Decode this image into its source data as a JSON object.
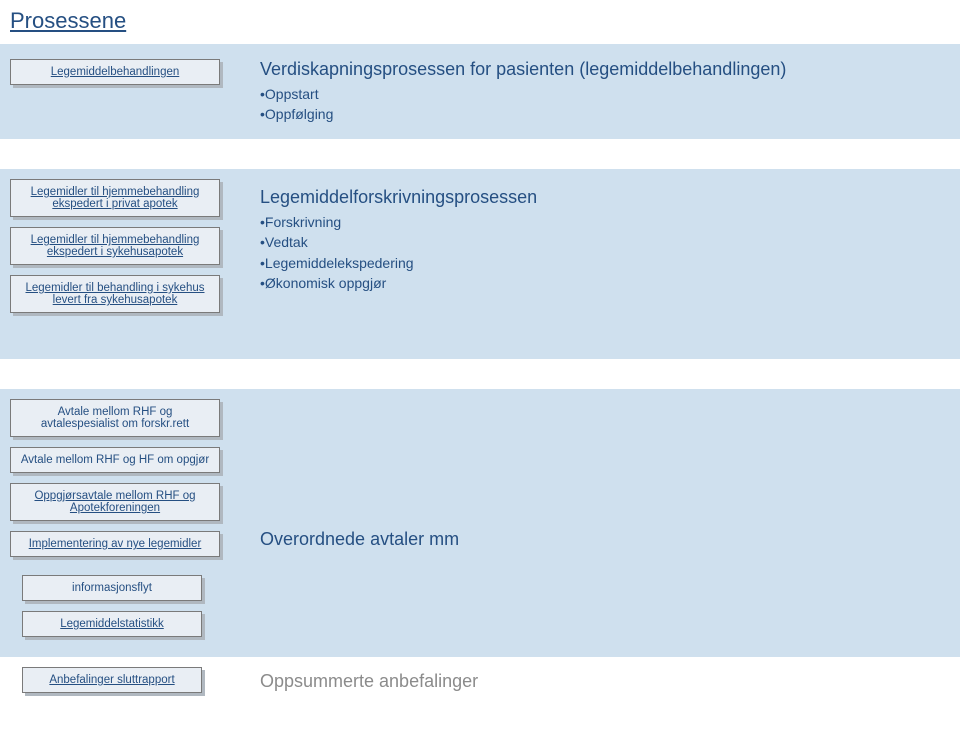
{
  "title": "Prosessene",
  "band1": {
    "box1": "Legemiddelbehandlingen",
    "desc_title": "Verdiskapningsprosessen for pasienten (legemiddelbehandlingen)",
    "desc_line1": "•Oppstart",
    "desc_line2": "•Oppfølging"
  },
  "band2": {
    "box1": "Legemidler til hjemmebehandling ekspedert i privat apotek",
    "box2": "Legemidler til hjemmebehandling ekspedert i sykehusapotek",
    "box3": "Legemidler til behandling i sykehus levert fra sykehusapotek",
    "desc_title": "Legemiddelforskrivningsprosessen",
    "desc_line1": "•Forskrivning",
    "desc_line2": "•Vedtak",
    "desc_line3": "•Legemiddelekspedering",
    "desc_line4": "•Økonomisk oppgjør"
  },
  "band3": {
    "box1": "Avtale mellom RHF og avtalespesialist om forskr.rett",
    "box2": "Avtale mellom RHF og HF om opgjør",
    "box3": "Oppgjørsavtale mellom RHF og Apotekforeningen",
    "box4": "Implementering av nye legemidler",
    "box5": "informasjonsflyt",
    "box6": "Legemiddelstatistikk",
    "desc_title": "Overordnede avtaler mm"
  },
  "band4": {
    "box1": "Anbefalinger sluttrapport",
    "desc_title": "Oppsummerte anbefalinger"
  }
}
